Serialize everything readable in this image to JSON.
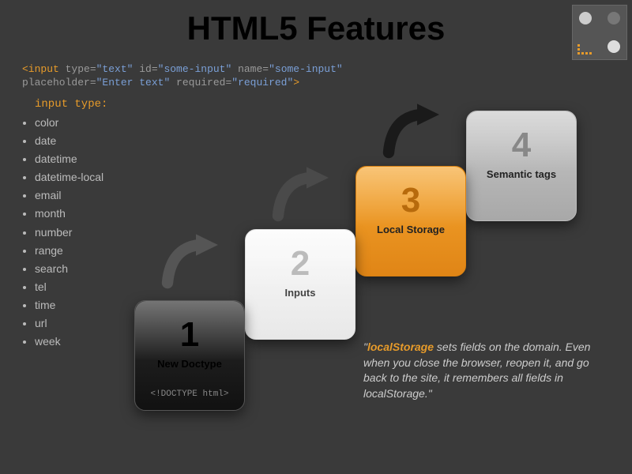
{
  "title": "HTML5 Features",
  "code_line1_a": "<input",
  "code_line1_b": " type=",
  "code_line1_c": "\"text\"",
  "code_line1_d": " id=",
  "code_line1_e": "\"some-input\"",
  "code_line1_f": " name=",
  "code_line1_g": "\"some-input\"",
  "code_line2_a": "placeholder=",
  "code_line2_b": "\"Enter text\"",
  "code_line2_c": " required=",
  "code_line2_d": "\"required\"",
  "code_line2_e": ">",
  "input_type_label": "input type:",
  "types": [
    "color",
    "date",
    "datetime",
    "datetime-local",
    "email",
    "month",
    "number",
    "range",
    "search",
    "tel",
    "time",
    "url",
    "week"
  ],
  "type0": "color",
  "type1": "date",
  "type2": "datetime",
  "type3": "datetime-local",
  "type4": "email",
  "type5": "month",
  "type6": "number",
  "type7": "range",
  "type8": "search",
  "type9": "tel",
  "type10": "time",
  "type11": "url",
  "type12": "week",
  "cards": {
    "c1": {
      "num": "1",
      "label": "New Doctype",
      "sub": "<!DOCTYPE html>"
    },
    "c2": {
      "num": "2",
      "label": "Inputs"
    },
    "c3": {
      "num": "3",
      "label": "Local Storage"
    },
    "c4": {
      "num": "4",
      "label": "Semantic tags"
    }
  },
  "quote_open": "\"",
  "quote_hl": "localStorage",
  "quote_rest": " sets fields on the domain. Even when you close the browser, reopen it, and go back to the site, it remembers all fields in localStorage.\""
}
